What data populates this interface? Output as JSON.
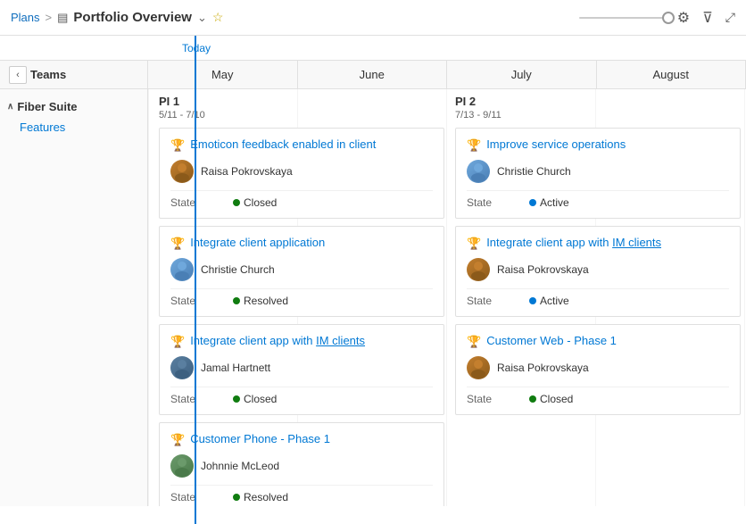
{
  "header": {
    "breadcrumb_plans": "Plans",
    "separator": ">",
    "portfolio_icon": "▤",
    "portfolio_title": "Portfolio Overview",
    "chevron": "⌄",
    "star": "☆",
    "today_label": "Today"
  },
  "months": [
    "May",
    "June",
    "July",
    "August"
  ],
  "sidebar": {
    "teams_label": "Teams",
    "group_name": "Fiber Suite",
    "group_item": "Features"
  },
  "pi1": {
    "title": "PI 1",
    "dates": "5/11 - 7/10",
    "cards": [
      {
        "title": "Emoticon feedback enabled in client",
        "person": "Raisa Pokrovskaya",
        "avatar_type": "rp",
        "state_label": "State",
        "state_value": "Closed",
        "state_type": "closed"
      },
      {
        "title": "Integrate client application",
        "person": "Christie Church",
        "avatar_type": "cc",
        "state_label": "State",
        "state_value": "Resolved",
        "state_type": "resolved"
      },
      {
        "title": "Integrate client app with IM clients",
        "highlight_start": 22,
        "highlight_end": 32,
        "person": "Jamal Hartnett",
        "avatar_type": "jh",
        "state_label": "State",
        "state_value": "Closed",
        "state_type": "closed"
      },
      {
        "title": "Customer Phone - Phase 1",
        "person": "Johnnie McLeod",
        "avatar_type": "jm",
        "state_label": "State",
        "state_value": "Resolved",
        "state_type": "resolved"
      }
    ]
  },
  "pi2": {
    "title": "PI 2",
    "dates": "7/13 - 9/11",
    "cards": [
      {
        "title": "Improve service operations",
        "person": "Christie Church",
        "avatar_type": "cc",
        "state_label": "State",
        "state_value": "Active",
        "state_type": "active"
      },
      {
        "title": "Integrate client app with IM clients",
        "person": "Raisa Pokrovskaya",
        "avatar_type": "rp",
        "state_label": "State",
        "state_value": "Active",
        "state_type": "active"
      },
      {
        "title": "Customer Web - Phase 1",
        "person": "Raisa Pokrovskaya",
        "avatar_type": "rp",
        "state_label": "State",
        "state_value": "Closed",
        "state_type": "closed"
      }
    ]
  }
}
